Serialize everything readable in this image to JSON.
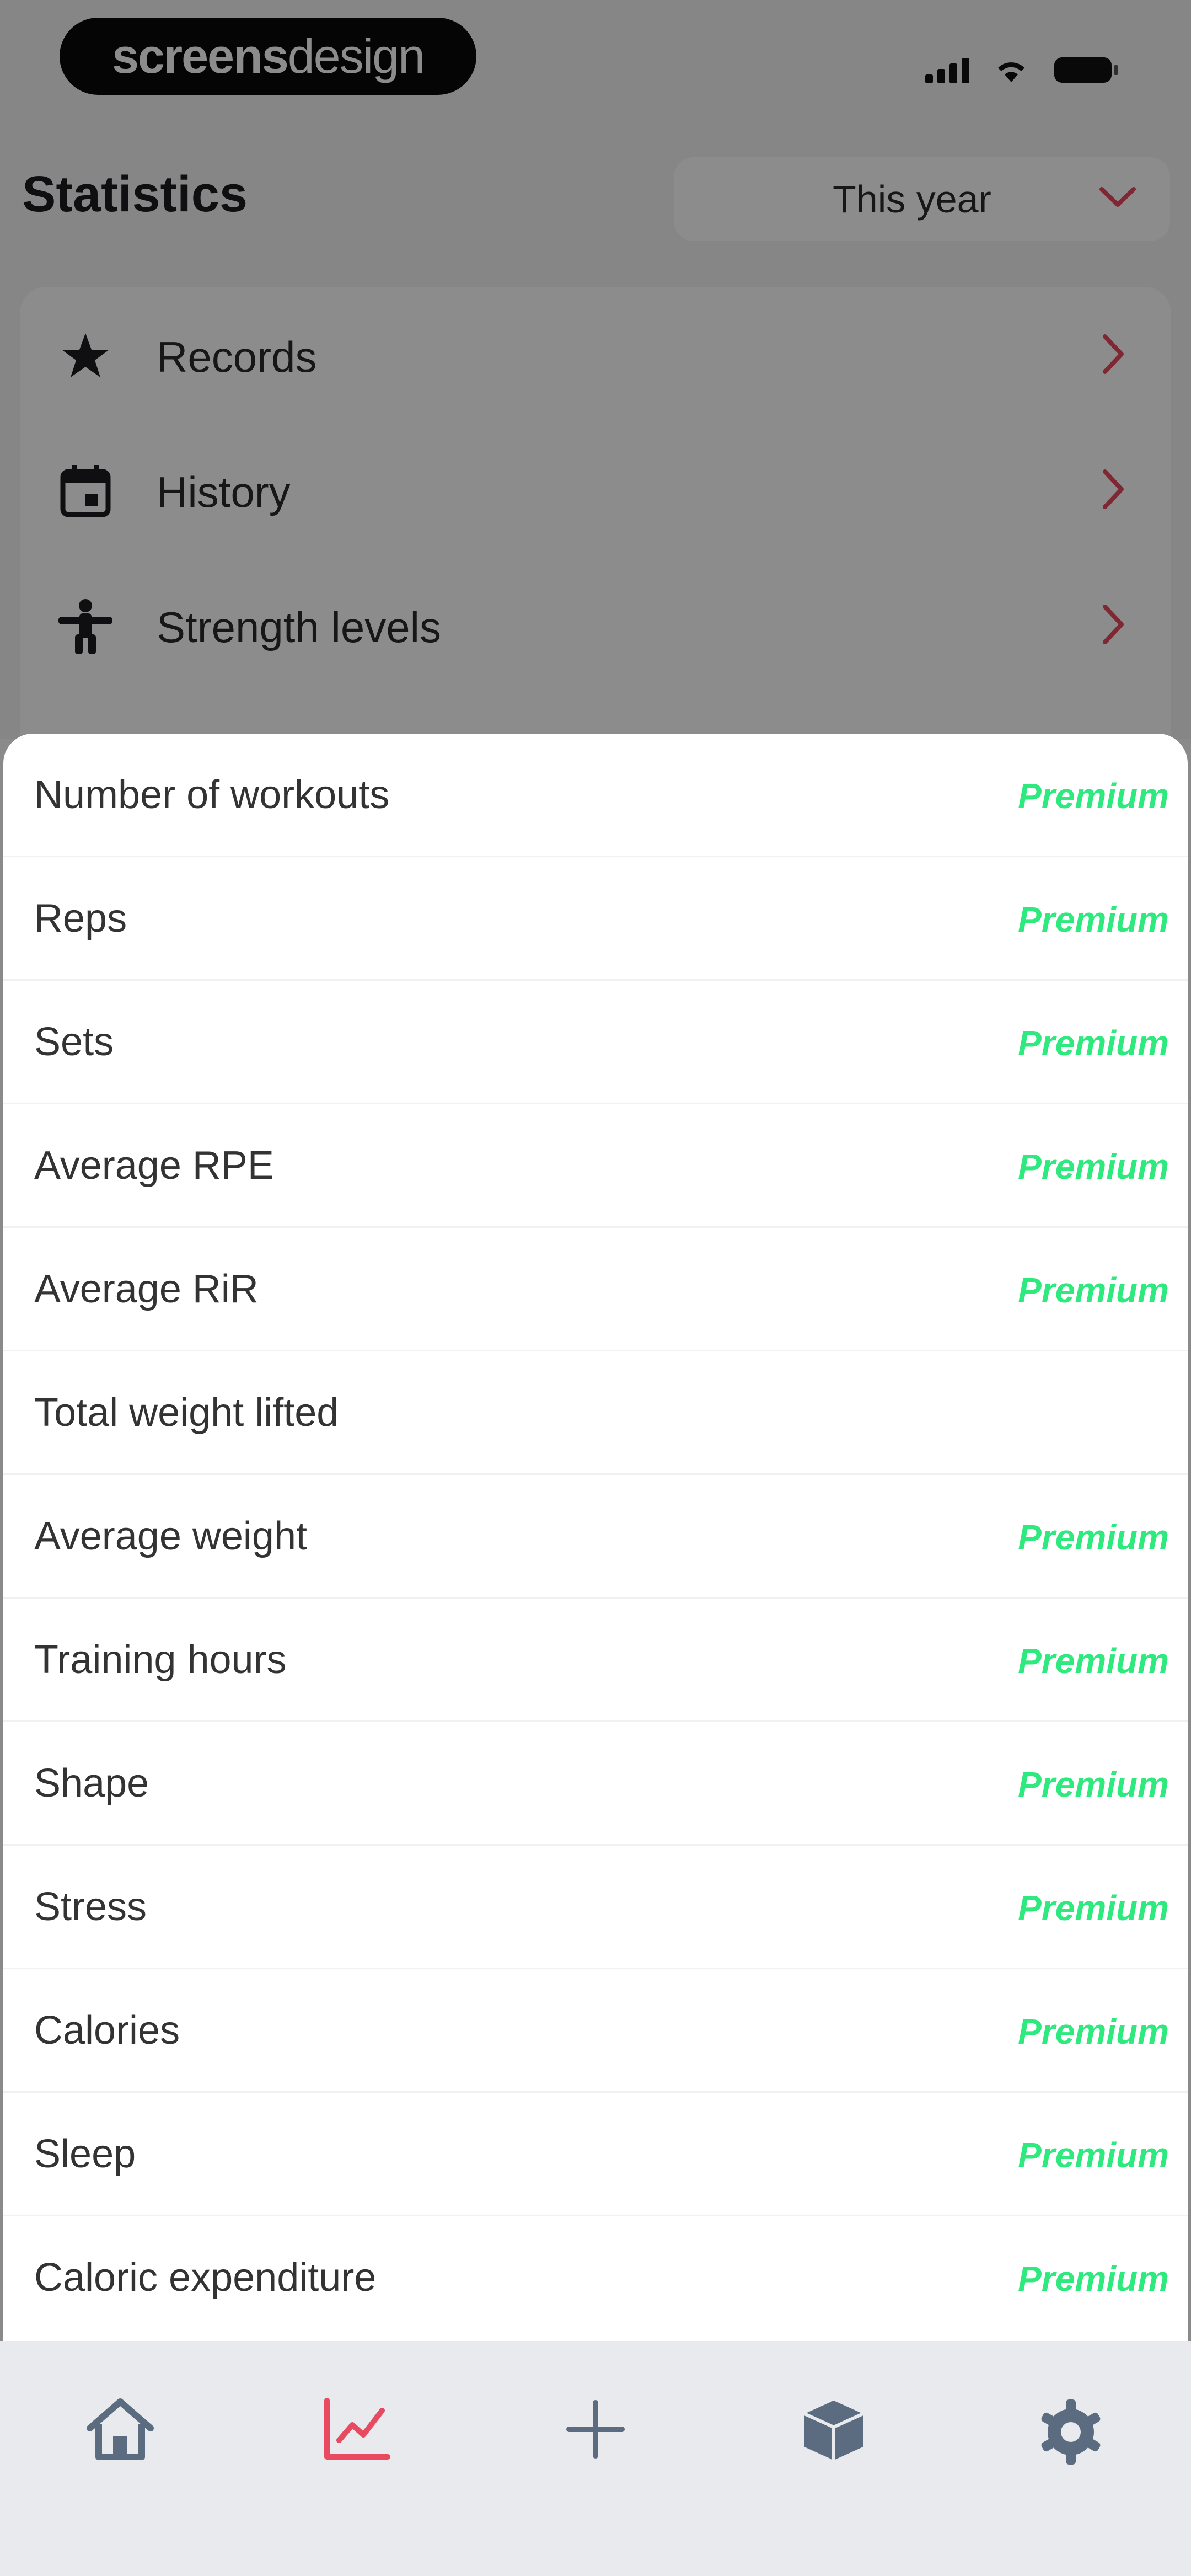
{
  "status_bar": {
    "brand_bold": "screens",
    "brand_light": "design"
  },
  "header": {
    "title": "Statistics",
    "period_selected": "This year"
  },
  "menu": {
    "items": [
      {
        "label": "Records",
        "icon": "star-icon"
      },
      {
        "label": "History",
        "icon": "calendar-icon"
      },
      {
        "label": "Strength levels",
        "icon": "figure-icon"
      }
    ]
  },
  "sheet": {
    "items": [
      {
        "label": "Number of workouts",
        "badge": "Premium"
      },
      {
        "label": "Reps",
        "badge": "Premium"
      },
      {
        "label": "Sets",
        "badge": "Premium"
      },
      {
        "label": "Average RPE",
        "badge": "Premium"
      },
      {
        "label": "Average RiR",
        "badge": "Premium"
      },
      {
        "label": "Total weight lifted",
        "badge": ""
      },
      {
        "label": "Average weight",
        "badge": "Premium"
      },
      {
        "label": "Training hours",
        "badge": "Premium"
      },
      {
        "label": "Shape",
        "badge": "Premium"
      },
      {
        "label": "Stress",
        "badge": "Premium"
      },
      {
        "label": "Calories",
        "badge": "Premium"
      },
      {
        "label": "Sleep",
        "badge": "Premium"
      },
      {
        "label": "Caloric expenditure",
        "badge": "Premium"
      }
    ]
  },
  "tabbar": {
    "tabs": [
      {
        "icon": "home-icon",
        "active": false
      },
      {
        "icon": "chart-icon",
        "active": true
      },
      {
        "icon": "plus-icon",
        "active": false
      },
      {
        "icon": "box-icon",
        "active": false
      },
      {
        "icon": "gear-icon",
        "active": false
      }
    ]
  },
  "colors": {
    "accent": "#e84a5f",
    "premium": "#2ee97e",
    "tab_icon": "#5b6b80"
  }
}
